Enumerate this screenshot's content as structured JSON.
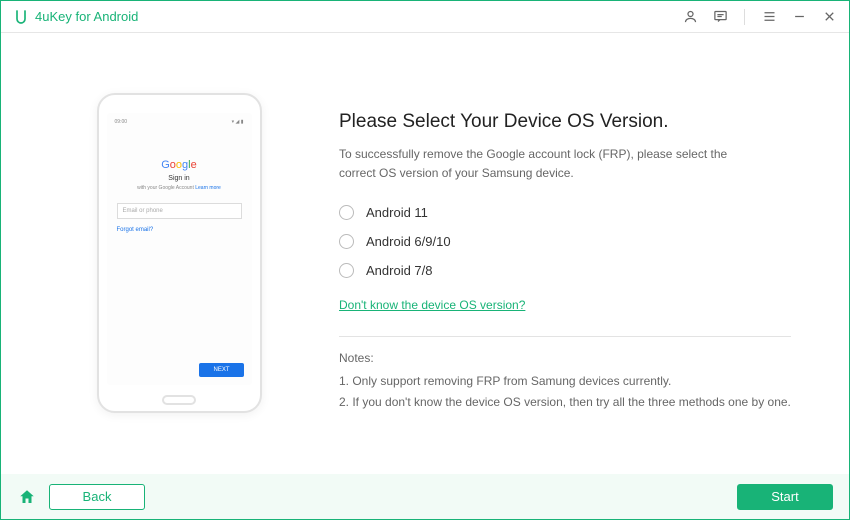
{
  "app": {
    "title": "4uKey for Android"
  },
  "phone": {
    "time": "09:00",
    "google": [
      "G",
      "o",
      "o",
      "g",
      "l",
      "e"
    ],
    "signin": "Sign in",
    "sub_prefix": "with your Google Account ",
    "sub_link": "Learn more",
    "input_placeholder": "Email or phone",
    "forgot": "Forgot email?",
    "next": "NEXT"
  },
  "main": {
    "heading": "Please Select Your Device OS Version.",
    "intro": "To successfully remove the Google account lock (FRP), please select the correct OS version of your Samsung device.",
    "options": [
      {
        "label": "Android 11"
      },
      {
        "label": "Android 6/9/10"
      },
      {
        "label": "Android 7/8"
      }
    ],
    "help_link": "Don't know the device OS version?",
    "notes_heading": "Notes:",
    "notes": [
      "1. Only support removing FRP from Samung devices currently.",
      "2. If you don't know the device OS version, then try all the three methods one by one."
    ]
  },
  "footer": {
    "back": "Back",
    "start": "Start"
  }
}
